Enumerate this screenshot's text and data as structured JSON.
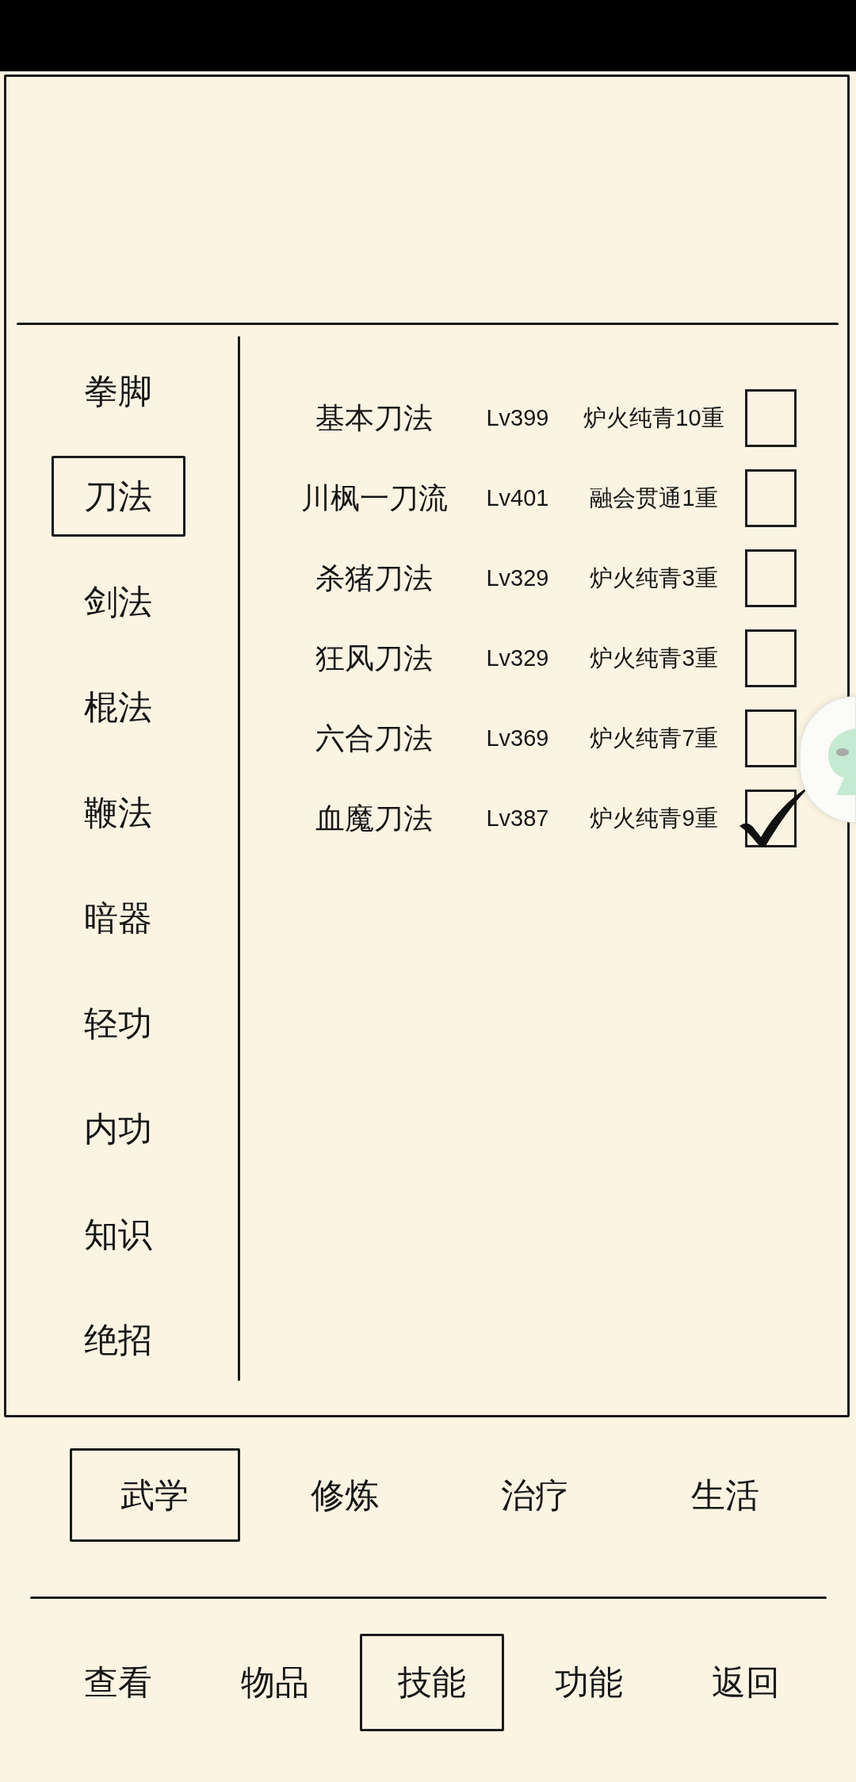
{
  "sidebar": {
    "items": [
      {
        "label": "拳脚",
        "selected": false
      },
      {
        "label": "刀法",
        "selected": true
      },
      {
        "label": "剑法",
        "selected": false
      },
      {
        "label": "棍法",
        "selected": false
      },
      {
        "label": "鞭法",
        "selected": false
      },
      {
        "label": "暗器",
        "selected": false
      },
      {
        "label": "轻功",
        "selected": false
      },
      {
        "label": "内功",
        "selected": false
      },
      {
        "label": "知识",
        "selected": false
      },
      {
        "label": "绝招",
        "selected": false
      }
    ]
  },
  "skills": [
    {
      "name": "基本刀法",
      "grade": "Lv399",
      "realm": "炉火纯青10重",
      "checked": false
    },
    {
      "name": "川枫一刀流",
      "grade": "Lv401",
      "realm": "融会贯通1重",
      "checked": false
    },
    {
      "name": "杀猪刀法",
      "grade": "Lv329",
      "realm": "炉火纯青3重",
      "checked": false
    },
    {
      "name": "狂风刀法",
      "grade": "Lv329",
      "realm": "炉火纯青3重",
      "checked": false
    },
    {
      "name": "六合刀法",
      "grade": "Lv369",
      "realm": "炉火纯青7重",
      "checked": false
    },
    {
      "name": "血魔刀法",
      "grade": "Lv387",
      "realm": "炉火纯青9重",
      "checked": true
    }
  ],
  "category_tabs": [
    {
      "label": "武学",
      "selected": true
    },
    {
      "label": "修炼",
      "selected": false
    },
    {
      "label": "治疗",
      "selected": false
    },
    {
      "label": "生活",
      "selected": false
    }
  ],
  "bottom_nav": [
    {
      "label": "查看",
      "selected": false
    },
    {
      "label": "物品",
      "selected": false
    },
    {
      "label": "技能",
      "selected": true
    },
    {
      "label": "功能",
      "selected": false
    },
    {
      "label": "返回",
      "selected": false
    }
  ]
}
